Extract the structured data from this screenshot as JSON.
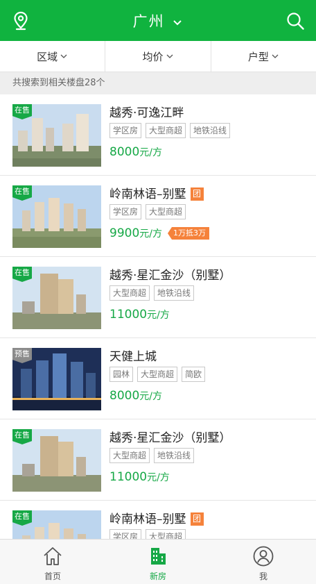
{
  "header": {
    "city": "广州",
    "location_icon": "location-pin-icon",
    "search_icon": "search-icon"
  },
  "filters": [
    {
      "label": "区域"
    },
    {
      "label": "均价"
    },
    {
      "label": "户型"
    }
  ],
  "result_count_text": "共搜索到相关楼盘28个",
  "colors": {
    "brand_green": "#10b33f",
    "price_green": "#16a846",
    "promo_orange": "#f5823b"
  },
  "listings": [
    {
      "status": "在售",
      "name": "越秀·可逸江畔",
      "group_buy": "",
      "tags": [
        "学区房",
        "大型商超",
        "地铁沿线"
      ],
      "price": "8000",
      "unit": "元/方",
      "promo": ""
    },
    {
      "status": "在售",
      "name": "岭南林语–别墅",
      "group_buy": "团",
      "tags": [
        "学区房",
        "大型商超"
      ],
      "price": "9900",
      "unit": "元/方",
      "promo": "1万抵3万"
    },
    {
      "status": "在售",
      "name": "越秀·星汇金沙（别墅）",
      "group_buy": "",
      "tags": [
        "大型商超",
        "地铁沿线"
      ],
      "price": "11000",
      "unit": "元/方",
      "promo": ""
    },
    {
      "status": "预售",
      "name": "天健上城",
      "group_buy": "",
      "tags": [
        "园林",
        "大型商超",
        "简欧"
      ],
      "price": "8000",
      "unit": "元/方",
      "promo": ""
    },
    {
      "status": "在售",
      "name": "越秀·星汇金沙（别墅）",
      "group_buy": "",
      "tags": [
        "大型商超",
        "地铁沿线"
      ],
      "price": "11000",
      "unit": "元/方",
      "promo": ""
    },
    {
      "status": "在售",
      "name": "岭南林语–别墅",
      "group_buy": "团",
      "tags": [
        "学区房",
        "大型商超"
      ],
      "price": "",
      "unit": "",
      "promo": ""
    }
  ],
  "tabbar": [
    {
      "label": "首页",
      "icon": "home-icon"
    },
    {
      "label": "新房",
      "icon": "buildings-icon",
      "active": true
    },
    {
      "label": "我",
      "icon": "user-icon"
    }
  ]
}
